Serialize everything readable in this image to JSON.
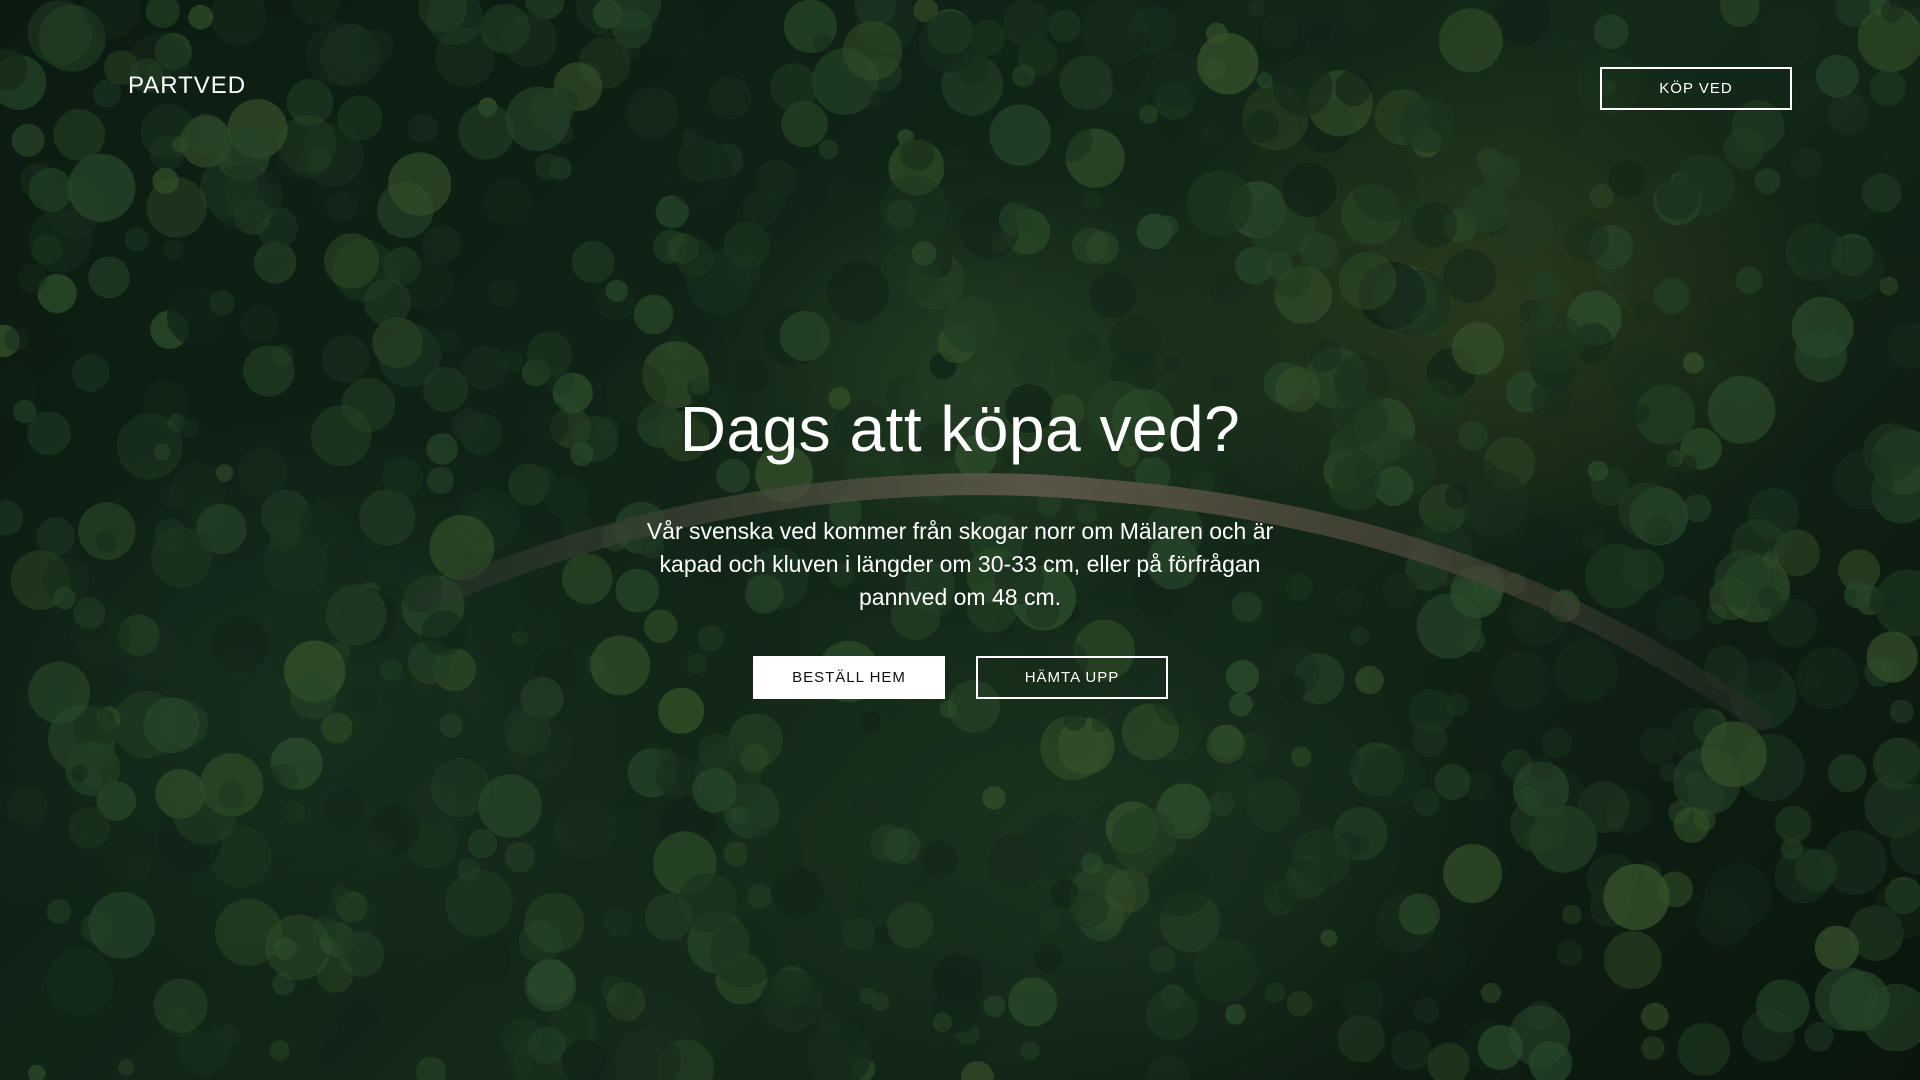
{
  "header": {
    "logo": "PARTVED",
    "nav_button": "KÖP VED"
  },
  "hero": {
    "headline": "Dags att köpa ved?",
    "body": "Vår svenska ved kommer från skogar norr om Mälaren och är kapad och kluven i längder om 30-33 cm, eller på förfrågan pannved om 48 cm.",
    "primary_button": "BESTÄLL HEM",
    "secondary_button": "HÄMTA UPP"
  },
  "colors": {
    "text": "#ffffff",
    "button_solid_bg": "#ffffff",
    "button_solid_text": "#111111",
    "background_forest": "#17321f"
  }
}
